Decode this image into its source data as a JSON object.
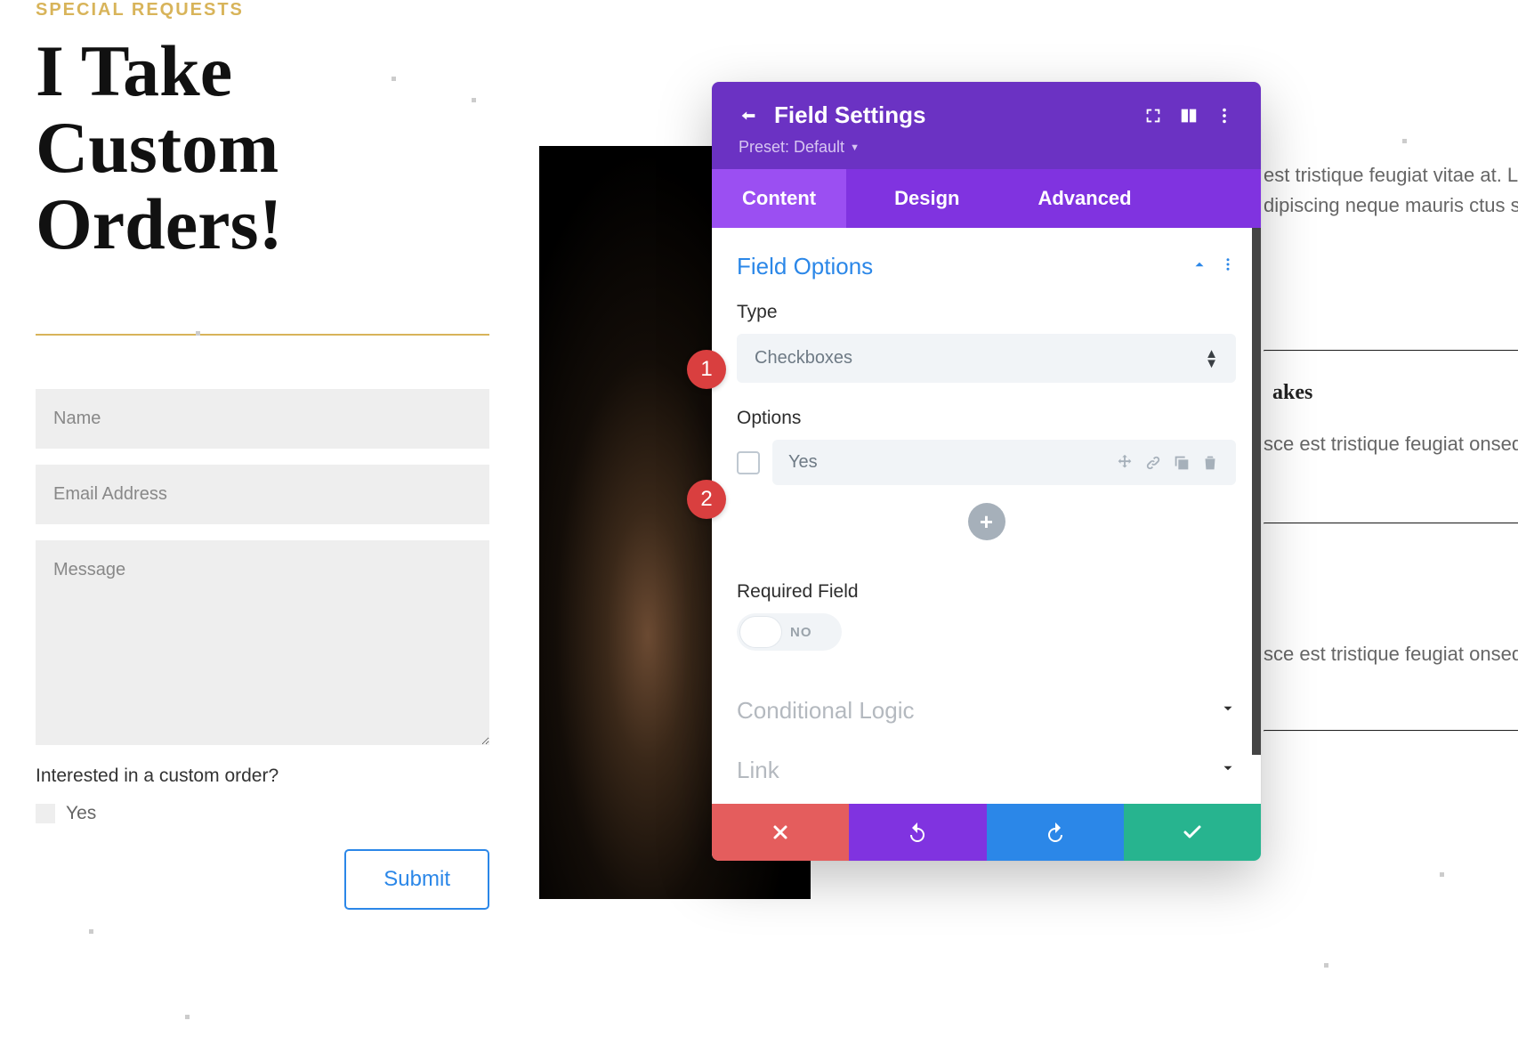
{
  "left": {
    "eyebrow": "SPECIAL REQUESTS",
    "headline": "I Take Custom Orders!",
    "name_placeholder": "Name",
    "email_placeholder": "Email Address",
    "message_placeholder": "Message",
    "checkbox_label": "Interested in a custom order?",
    "checkbox_option": "Yes",
    "submit_label": "Submit"
  },
  "right": {
    "para": "est tristique feugiat vitae at. Lorem lectus felis, dipiscing neque mauris ctus sapien sed sit.",
    "item1_title": "akes",
    "item1_desc": "sce est tristique feugiat onsequat oreme.",
    "item2_desc": "sce est tristique feugiat onsequat oreme."
  },
  "modal": {
    "title": "Field Settings",
    "preset_label": "Preset: Default",
    "tabs": {
      "content": "Content",
      "design": "Design",
      "advanced": "Advanced"
    },
    "sections": {
      "field_options": "Field Options",
      "conditional_logic": "Conditional Logic",
      "link": "Link"
    },
    "type_label": "Type",
    "type_value": "Checkboxes",
    "options_label": "Options",
    "option_value": "Yes",
    "required_label": "Required Field",
    "required_value": "NO"
  },
  "badges": {
    "one": "1",
    "two": "2"
  },
  "icons": {
    "add": "+"
  }
}
